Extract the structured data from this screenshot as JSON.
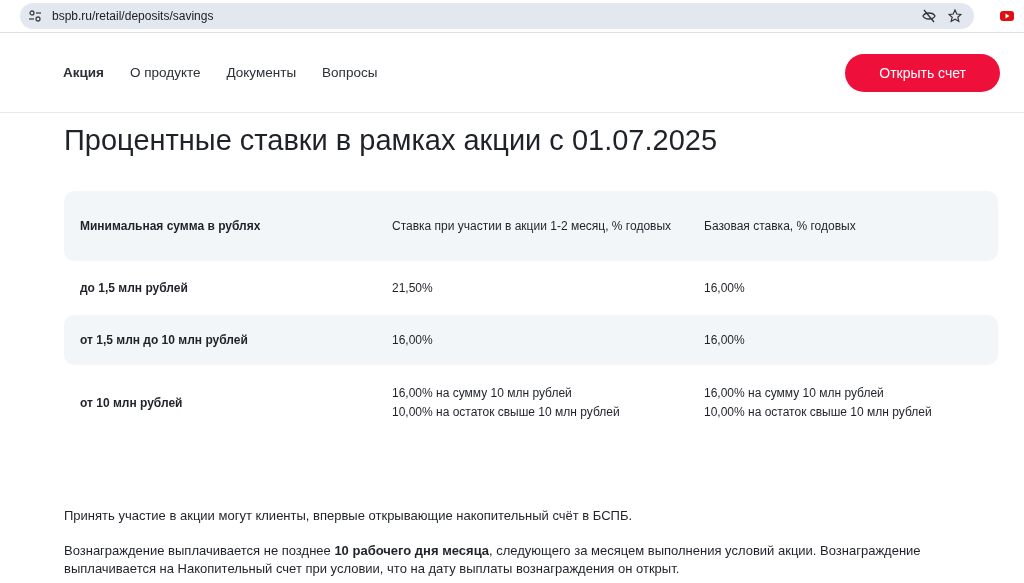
{
  "browser": {
    "url": "bspb.ru/retail/deposits/savings"
  },
  "nav": {
    "tabs": [
      {
        "label": "Акция",
        "selected": true
      },
      {
        "label": "О продукте",
        "selected": false
      },
      {
        "label": "Документы",
        "selected": false
      },
      {
        "label": "Вопросы",
        "selected": false
      }
    ],
    "button": "Открыть счет"
  },
  "title": "Процентные ставки в рамках акции с 01.07.2025",
  "table": {
    "columns": [
      "Минимальная сумма в рублях",
      "Ставка при участии в акции 1-2 месяц, % годовых",
      "Базовая ставка, % годовых"
    ],
    "rows": [
      {
        "cells": [
          "до 1,5 млн рублей",
          [
            "21,50%"
          ],
          [
            "16,00%"
          ]
        ]
      },
      {
        "cells": [
          "от 1,5 млн до 10 млн рублей",
          [
            "16,00%"
          ],
          [
            "16,00%"
          ]
        ]
      },
      {
        "cells": [
          "от 10 млн рублей",
          [
            "16,00% на сумму 10 млн рублей",
            "10,00% на остаток свыше 10 млн рублей"
          ],
          [
            "16,00% на сумму 10 млн рублей",
            "10,00% на остаток свыше 10 млн рублей"
          ]
        ]
      }
    ]
  },
  "paragraphs": [
    "Принять участие в акции могут клиенты, впервые открывающие накопительный счёт в БСПБ.",
    "Вознаграждение выплачивается  не позднее **10 рабочего дня месяца**, следующего за месяцем выполнения условий акции. Вознаграждение выплачивается на Накопительный счет при условии, что на дату выплаты вознаграждения он открыт."
  ]
}
